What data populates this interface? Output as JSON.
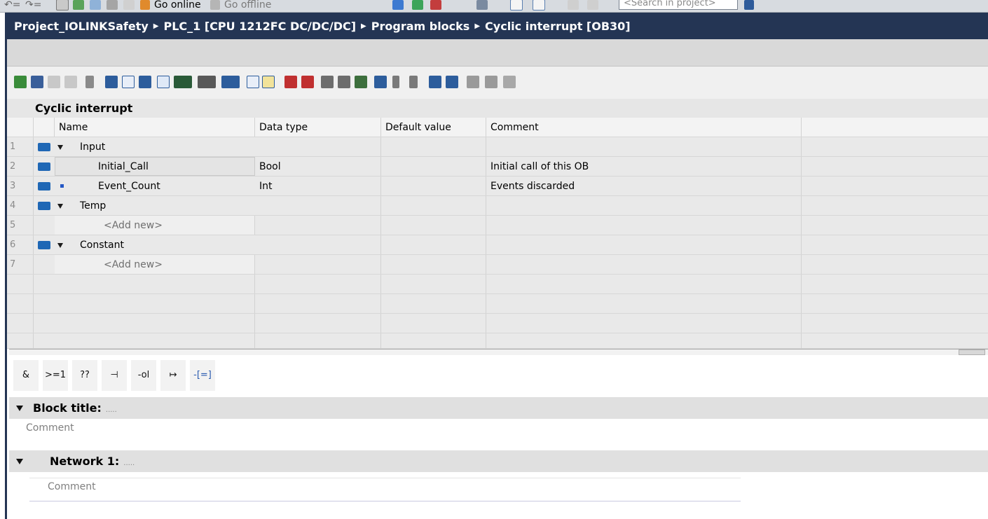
{
  "toolbar_top": {
    "go_online_label": "Go online",
    "go_offline_label": "Go offline",
    "search_placeholder": "<Search in project>"
  },
  "breadcrumb": [
    "Project_IOLINKSafety",
    "PLC_1 [CPU 1212FC DC/DC/DC]",
    "Program blocks",
    "Cyclic interrupt [OB30]"
  ],
  "interface": {
    "title": "Cyclic interrupt",
    "columns": [
      "Name",
      "Data type",
      "Default value",
      "Comment"
    ],
    "rows": [
      {
        "num": "1",
        "name": "Input",
        "type": "",
        "default": "",
        "comment": ""
      },
      {
        "num": "2",
        "name": "Initial_Call",
        "type": "Bool",
        "default": "",
        "comment": "Initial call of this OB"
      },
      {
        "num": "3",
        "name": "Event_Count",
        "type": "Int",
        "default": "",
        "comment": "Events discarded"
      },
      {
        "num": "4",
        "name": "Temp",
        "type": "",
        "default": "",
        "comment": ""
      },
      {
        "num": "5",
        "name": "<Add new>",
        "type": "",
        "default": "",
        "comment": ""
      },
      {
        "num": "6",
        "name": "Constant",
        "type": "",
        "default": "",
        "comment": ""
      },
      {
        "num": "7",
        "name": "<Add new>",
        "type": "",
        "default": "",
        "comment": ""
      }
    ]
  },
  "instructions": [
    "&",
    ">=1",
    "??",
    "⊣",
    "-ol",
    "↦",
    "-[=]"
  ],
  "block": {
    "title_label": "Block title:",
    "title_dots": ".....",
    "comment_placeholder": "Comment"
  },
  "network": {
    "label": "Network 1:",
    "dots": ".....",
    "comment_placeholder": "Comment"
  },
  "colors": {
    "breadcrumb_bg": "#243554",
    "interface_icon": "#1f67b5",
    "bullet": "#2457c5"
  }
}
